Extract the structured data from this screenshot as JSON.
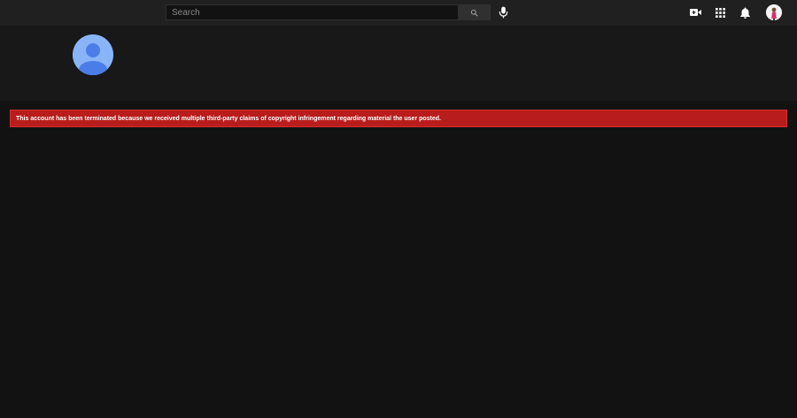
{
  "search": {
    "placeholder": "Search",
    "value": ""
  },
  "icons": {
    "search_button": "search-icon",
    "mic_button": "mic-icon",
    "create_button": "video-camera-plus-icon",
    "apps_button": "apps-grid-icon",
    "notifications_button": "bell-icon",
    "account": "account-avatar-icon",
    "channel_avatar": "default-user-avatar-icon"
  },
  "banner": {
    "message": "This account has been terminated because we received multiple third-party claims of copyright infringement regarding material the user posted."
  },
  "colors": {
    "page_background": "#121212",
    "topbar_background": "#202020",
    "header_background": "#181818",
    "banner_background": "#b91c1c",
    "avatar_background": "#8ab4f8",
    "avatar_figure": "#4a7de8"
  }
}
